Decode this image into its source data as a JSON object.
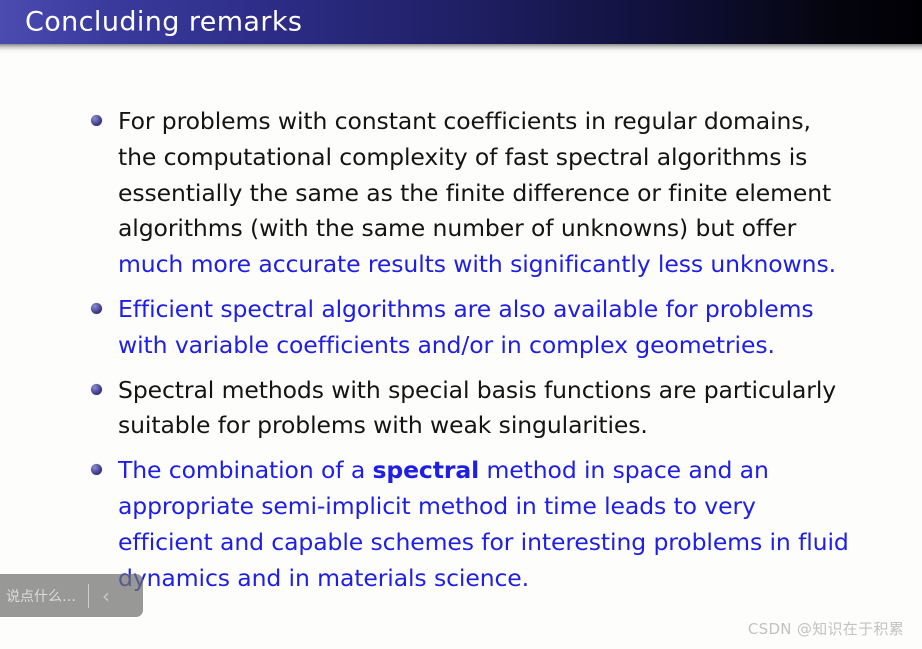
{
  "slide": {
    "title": "Concluding remarks",
    "background_color": "#fdfdfb",
    "title_gradient_from": "#4b4bb0",
    "title_gradient_to": "#000004",
    "title_text_color": "#ffffff",
    "body_text_color": "#141414",
    "accent_blue": "#1e1ee6",
    "bullet_color": "#32327f"
  },
  "bullets": [
    {
      "id": "bullet-1",
      "black_part": "For problems with constant coefficients in regular domains,\nthe computational complexity of fast spectral algorithms is\nessentially the same as the finite difference or finite element\nalgorithms (with the same number of unknowns) but offer\n",
      "blue_part": "much more accurate results with significantly less unknowns.",
      "style": "mixed"
    },
    {
      "id": "bullet-2",
      "text": "Efficient spectral algorithms are also available for problems\nwith variable coefficients and/or in complex geometries.",
      "style": "blue"
    },
    {
      "id": "bullet-3",
      "text": "Spectral methods with special basis functions are particularly\nsuitable for problems with weak singularities.",
      "style": "black"
    },
    {
      "id": "bullet-4",
      "lead": "The combination of a ",
      "emphasis": "spectral",
      "tail": " method in space and an\nappropriate semi-implicit method in time leads to very\nefficient and capable schemes for interesting problems in fluid\ndynamics and in materials science.",
      "style": "blue-with-bold"
    }
  ],
  "comment_bar": {
    "placeholder": "说点什么…",
    "chevron_icon": "‹"
  },
  "watermark": {
    "text": "CSDN @知识在于积累"
  }
}
